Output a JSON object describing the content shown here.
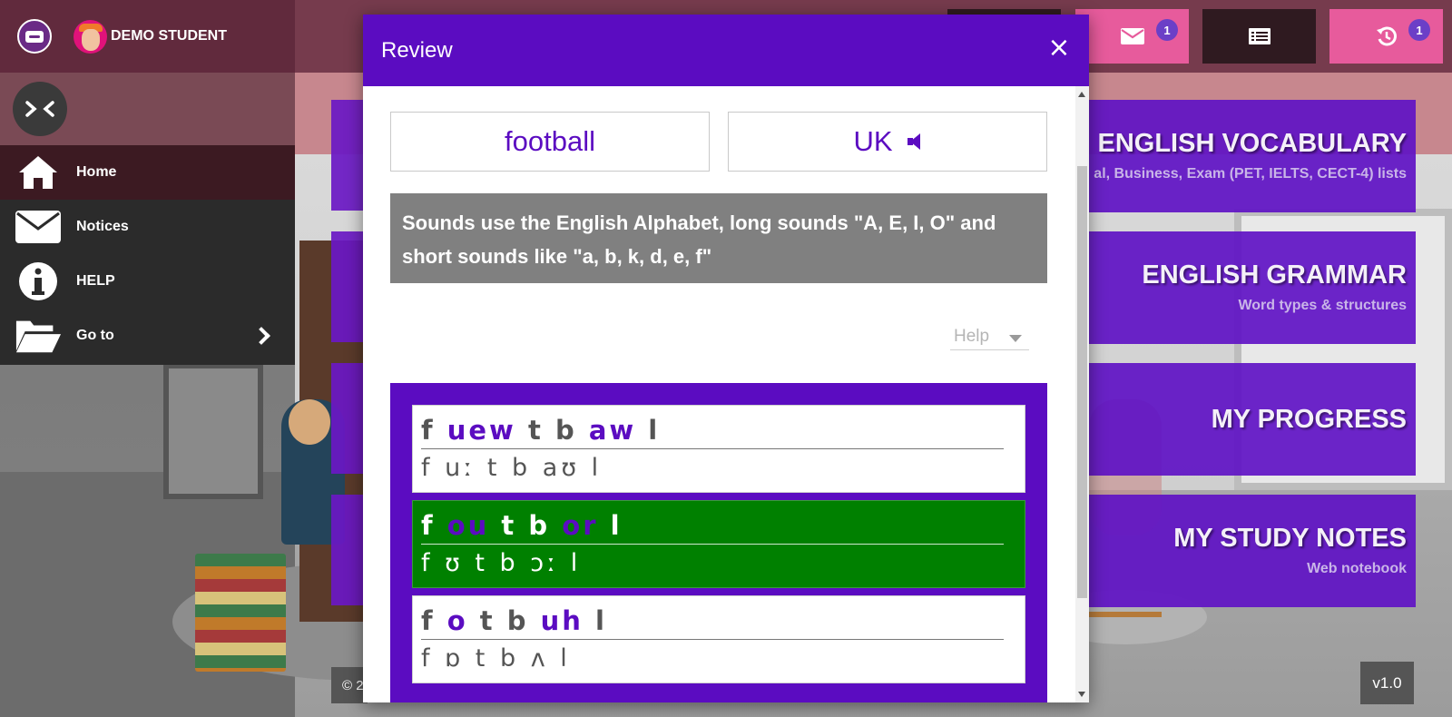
{
  "header": {
    "user_name": "DEMO STUDENT",
    "mail_badge": "1",
    "history_badge": "1"
  },
  "sidebar": {
    "items": [
      {
        "label": "Home",
        "icon": "home-icon"
      },
      {
        "label": "Notices",
        "icon": "envelope-icon"
      },
      {
        "label": "HELP",
        "icon": "info-icon"
      },
      {
        "label": "Go to",
        "icon": "folder-open-icon"
      }
    ]
  },
  "cards": [
    {
      "title": "ENGLISH VOCABULARY",
      "subtitle": "al, Business, Exam (PET, IELTS, CECT-4) lists"
    },
    {
      "title": "ENGLISH GRAMMAR",
      "subtitle": "Word types & structures"
    },
    {
      "title": "MY PROGRESS",
      "subtitle": ""
    },
    {
      "title": "MY STUDY NOTES",
      "subtitle": "Web notebook"
    }
  ],
  "footer": {
    "copyright_fragment": "© 2",
    "version": "v1.0"
  },
  "modal": {
    "title": "Review",
    "close": "×",
    "word": "football",
    "accent": "UK",
    "info": "Sounds use the English Alphabet, long sounds \"A, E, I, O\" and short sounds like \"a, b, k, d, e, f\"",
    "help_label": "Help",
    "options": [
      {
        "segments": [
          {
            "text": "f",
            "vowel": false
          },
          {
            "text": "uew",
            "vowel": true
          },
          {
            "text": "t",
            "vowel": false
          },
          {
            "text": "b",
            "vowel": false
          },
          {
            "text": "aw",
            "vowel": true
          },
          {
            "text": "l",
            "vowel": false
          }
        ],
        "ipa": "f uː t b aʊ l",
        "correct": false
      },
      {
        "segments": [
          {
            "text": "f",
            "vowel": false
          },
          {
            "text": "ou",
            "vowel": true
          },
          {
            "text": "t",
            "vowel": false
          },
          {
            "text": "b",
            "vowel": false
          },
          {
            "text": "or",
            "vowel": true
          },
          {
            "text": "l",
            "vowel": false
          }
        ],
        "ipa": "f ʊ t b ɔː l",
        "correct": true
      },
      {
        "segments": [
          {
            "text": "f",
            "vowel": false
          },
          {
            "text": "o",
            "vowel": true
          },
          {
            "text": "t",
            "vowel": false
          },
          {
            "text": "b",
            "vowel": false
          },
          {
            "text": "uh",
            "vowel": true
          },
          {
            "text": "l",
            "vowel": false
          }
        ],
        "ipa": "f ɒ t b ʌ l",
        "correct": false
      }
    ]
  },
  "colors": {
    "brand_purple": "#5b0cc1",
    "correct_green": "#008000",
    "pink_button": "#e75b9c",
    "info_gray": "#808080"
  }
}
